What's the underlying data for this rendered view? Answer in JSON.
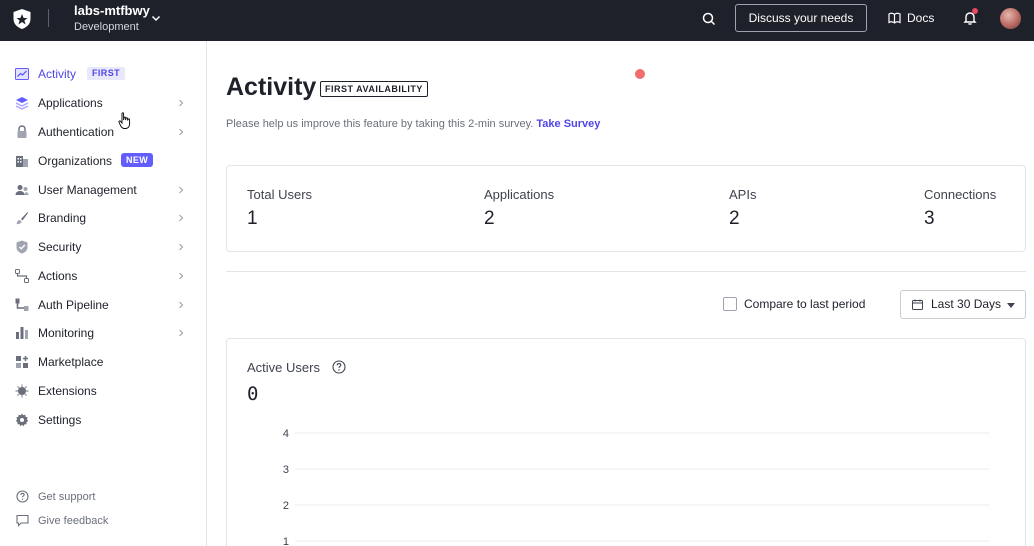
{
  "topbar": {
    "tenant_name": "labs-mtfbwy",
    "tenant_env": "Development",
    "discuss_label": "Discuss your needs",
    "docs_label": "Docs"
  },
  "sidebar": {
    "items": [
      {
        "label": "Activity",
        "icon": "activity-icon",
        "badge": "FIRST",
        "active": true
      },
      {
        "label": "Applications",
        "icon": "applications-icon",
        "chevron": true
      },
      {
        "label": "Authentication",
        "icon": "lock-icon",
        "chevron": true
      },
      {
        "label": "Organizations",
        "icon": "building-icon",
        "badge": "NEW"
      },
      {
        "label": "User Management",
        "icon": "users-icon",
        "chevron": true
      },
      {
        "label": "Branding",
        "icon": "brush-icon",
        "chevron": true
      },
      {
        "label": "Security",
        "icon": "shield-icon",
        "chevron": true
      },
      {
        "label": "Actions",
        "icon": "flow-icon",
        "chevron": true
      },
      {
        "label": "Auth Pipeline",
        "icon": "pipeline-icon",
        "chevron": true
      },
      {
        "label": "Monitoring",
        "icon": "bar-chart-icon",
        "chevron": true
      },
      {
        "label": "Marketplace",
        "icon": "grid-plus-icon"
      },
      {
        "label": "Extensions",
        "icon": "puzzle-icon"
      },
      {
        "label": "Settings",
        "icon": "gear-icon"
      }
    ],
    "footer": {
      "support_label": "Get support",
      "feedback_label": "Give feedback"
    }
  },
  "main": {
    "title": "Activity",
    "title_badge": "FIRST AVAILABILITY",
    "survey_text": "Please help us improve this feature by taking this 2-min survey.",
    "survey_link": "Take Survey",
    "stats": [
      {
        "label": "Total Users",
        "value": "1"
      },
      {
        "label": "Applications",
        "value": "2"
      },
      {
        "label": "APIs",
        "value": "2"
      },
      {
        "label": "Connections",
        "value": "3"
      }
    ],
    "compare_label": "Compare to last period",
    "compare_checked": false,
    "range_label": "Last 30 Days",
    "active_users_title": "Active Users",
    "active_users_value": "0"
  },
  "chart_data": {
    "type": "line",
    "title": "Active Users",
    "ylim": [
      0,
      4
    ],
    "yticks": [
      "4",
      "3",
      "2",
      "1"
    ],
    "grid": true
  },
  "colors": {
    "topbar_bg": "#1e212a",
    "accent": "#635dff",
    "link": "#4f46e5"
  }
}
